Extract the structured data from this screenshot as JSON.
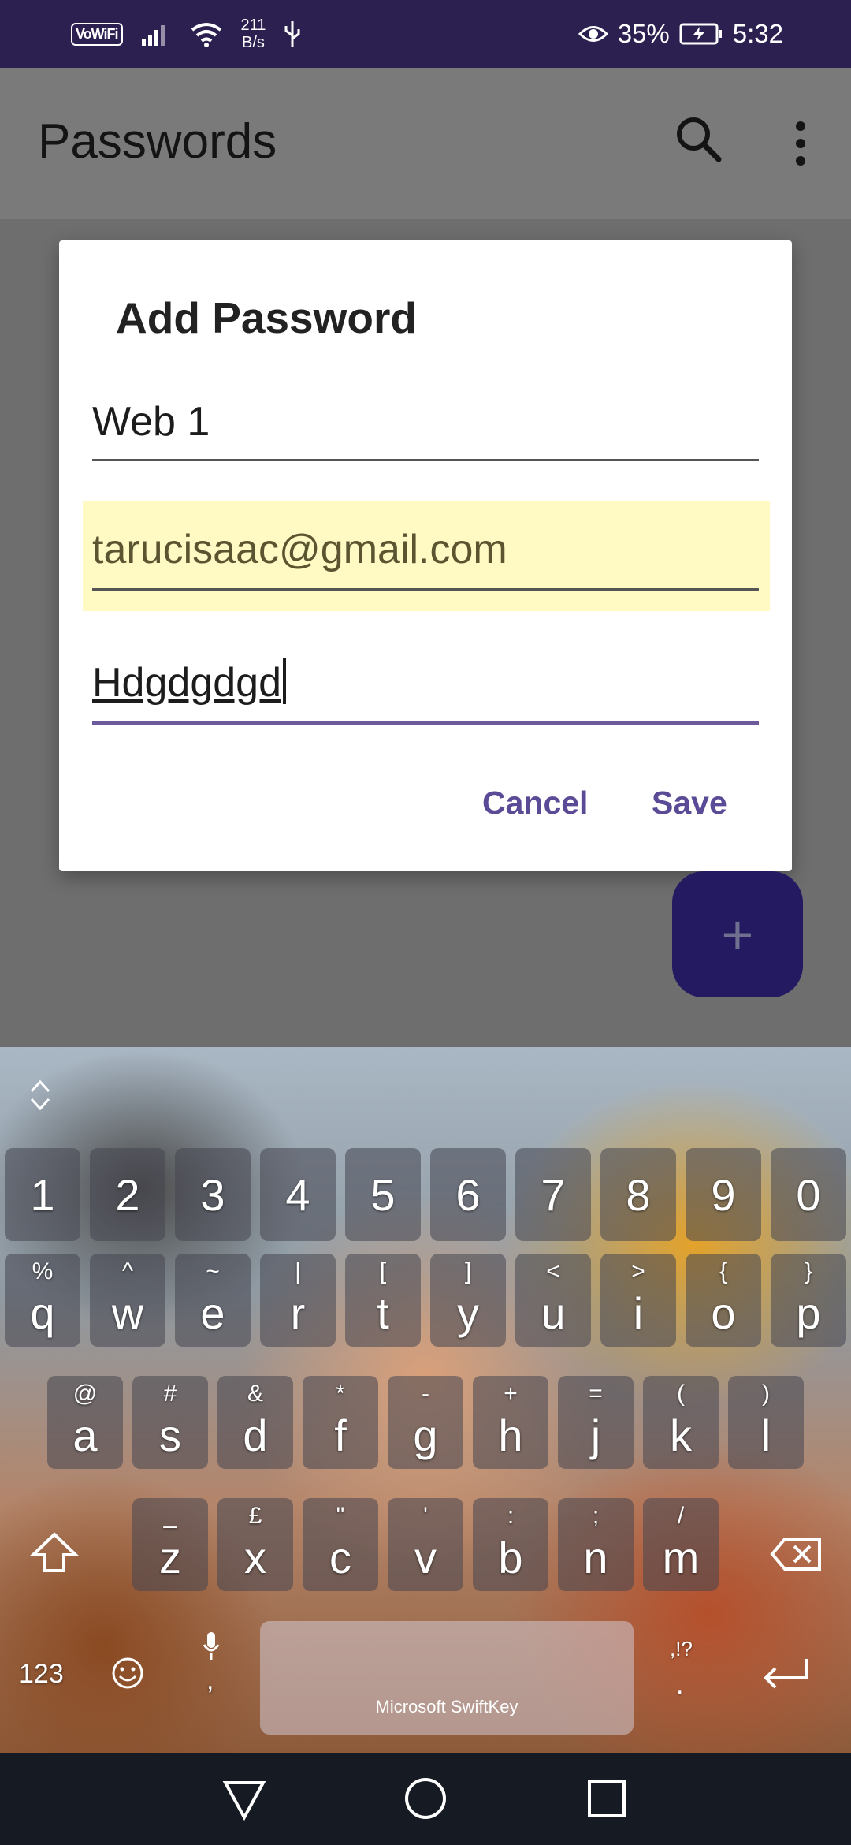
{
  "status_bar": {
    "vowifi": "VoWiFi",
    "net_speed_value": "211",
    "net_speed_unit": "B/s",
    "battery": "35%",
    "time": "5:32"
  },
  "app_bar": {
    "title": "Passwords"
  },
  "dialog": {
    "title": "Add Password",
    "name_value": "Web 1",
    "email_value": "tarucisaac@gmail.com",
    "password_value": "Hdgdgdgd",
    "cancel_label": "Cancel",
    "save_label": "Save"
  },
  "fab": {
    "label": "+"
  },
  "keyboard": {
    "number_row": [
      "1",
      "2",
      "3",
      "4",
      "5",
      "6",
      "7",
      "8",
      "9",
      "0"
    ],
    "row1": [
      {
        "main": "q",
        "sub": "%"
      },
      {
        "main": "w",
        "sub": "^"
      },
      {
        "main": "e",
        "sub": "~"
      },
      {
        "main": "r",
        "sub": "|"
      },
      {
        "main": "t",
        "sub": "["
      },
      {
        "main": "y",
        "sub": "]"
      },
      {
        "main": "u",
        "sub": "<"
      },
      {
        "main": "i",
        "sub": ">"
      },
      {
        "main": "o",
        "sub": "{"
      },
      {
        "main": "p",
        "sub": "}"
      }
    ],
    "row2": [
      {
        "main": "a",
        "sub": "@"
      },
      {
        "main": "s",
        "sub": "#"
      },
      {
        "main": "d",
        "sub": "&"
      },
      {
        "main": "f",
        "sub": "*"
      },
      {
        "main": "g",
        "sub": "-"
      },
      {
        "main": "h",
        "sub": "+"
      },
      {
        "main": "j",
        "sub": "="
      },
      {
        "main": "k",
        "sub": "("
      },
      {
        "main": "l",
        "sub": ")"
      }
    ],
    "row3": [
      {
        "main": "z",
        "sub": "_"
      },
      {
        "main": "x",
        "sub": "£"
      },
      {
        "main": "c",
        "sub": "\""
      },
      {
        "main": "v",
        "sub": "'"
      },
      {
        "main": "b",
        "sub": ":"
      },
      {
        "main": "n",
        "sub": ";"
      },
      {
        "main": "m",
        "sub": "/"
      }
    ],
    "numbers_label": "123",
    "comma": ",",
    "space_label": "Microsoft SwiftKey",
    "punct_sub": ",!?",
    "period": "."
  },
  "colors": {
    "status_bar": "#2b2050",
    "accent": "#5b4a96",
    "fab": "#231a62",
    "highlight": "#fff9c4"
  }
}
